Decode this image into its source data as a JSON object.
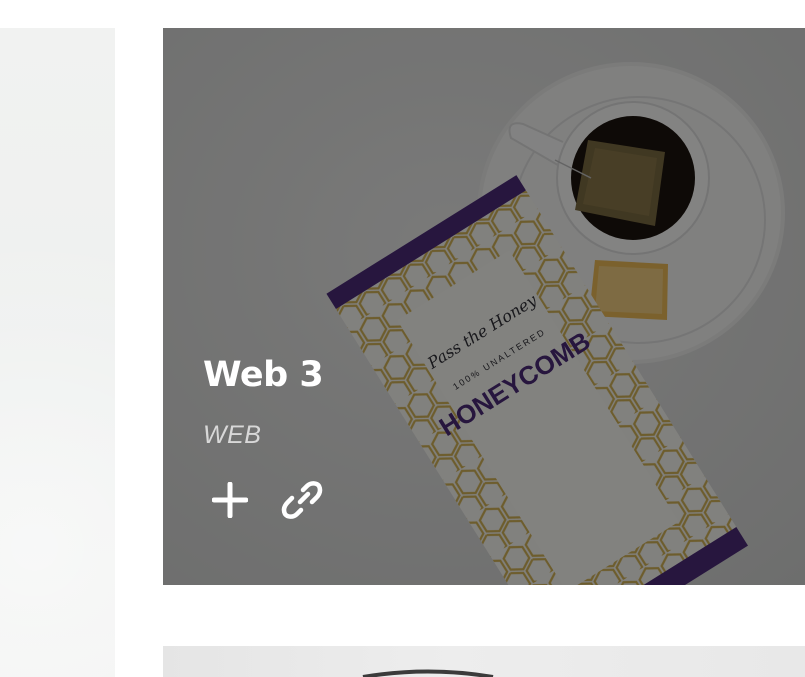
{
  "portfolio": {
    "items": [
      {
        "title": "Web 3",
        "category": "WEB",
        "actions": [
          {
            "name": "plus-icon"
          },
          {
            "name": "link-icon"
          }
        ]
      }
    ]
  },
  "photo_text": {
    "brand": "Pass the Honey",
    "tagline": "100% UNALTERED",
    "product": "HONEYCOMB"
  },
  "colors": {
    "overlay": "#000000",
    "title": "#ffffff",
    "category": "#d8d8d8",
    "accent_purple": "#4a2a76",
    "honey_gold": "#c9a43a"
  }
}
